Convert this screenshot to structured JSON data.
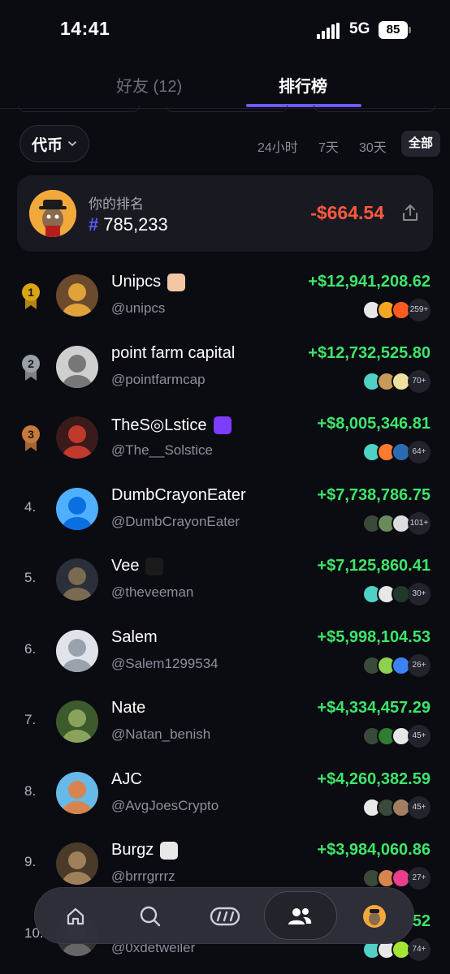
{
  "status": {
    "time": "14:41",
    "network": "5G",
    "battery": "85"
  },
  "tabs": {
    "friends": "好友 (12)",
    "ranking": "排行榜"
  },
  "filters": {
    "token_select": "代币",
    "periods": [
      "24小时",
      "7天",
      "30天",
      "全部"
    ],
    "selected": "全部"
  },
  "my_rank": {
    "label": "你的排名",
    "hash": "#",
    "value": "785,233",
    "pnl": "-$664.54"
  },
  "leaderboard": [
    {
      "rank": "1",
      "name": "Unipcs",
      "handle": "@unipcs",
      "pnl": "+$12,941,208.62",
      "more": "259+",
      "medal": "gold"
    },
    {
      "rank": "2",
      "name": "point farm capital",
      "handle": "@pointfarmcap",
      "pnl": "+$12,732,525.80",
      "more": "70+",
      "medal": "silver"
    },
    {
      "rank": "3",
      "name": "TheS◎Lstice",
      "handle": "@The__Solstice",
      "pnl": "+$8,005,346.81",
      "more": "64+",
      "medal": "bronze"
    },
    {
      "rank": "4.",
      "name": "DumbCrayonEater",
      "handle": "@DumbCrayonEater",
      "pnl": "+$7,738,786.75",
      "more": "101+"
    },
    {
      "rank": "5.",
      "name": "Vee",
      "handle": "@theveeman",
      "pnl": "+$7,125,860.41",
      "more": "30+"
    },
    {
      "rank": "6.",
      "name": "Salem",
      "handle": "@Salem1299534",
      "pnl": "+$5,998,104.53",
      "more": "26+"
    },
    {
      "rank": "7.",
      "name": "Nate",
      "handle": "@Natan_benish",
      "pnl": "+$4,334,457.29",
      "more": "45+"
    },
    {
      "rank": "8.",
      "name": "AJC",
      "handle": "@AvgJoesCrypto",
      "pnl": "+$4,260,382.59",
      "more": "45+"
    },
    {
      "rank": "9.",
      "name": "Burgz",
      "handle": "@brrrgrrrz",
      "pnl": "+$3,984,060.86",
      "more": "27+"
    },
    {
      "rank": "10.",
      "name": "",
      "handle": "@0xdetweiler",
      "pnl": "52",
      "more": "74+"
    }
  ],
  "nav": [
    "home-icon",
    "search-icon",
    "token-icon",
    "friends-icon",
    "profile-avatar"
  ],
  "colors": {
    "accent": "#6a5cff",
    "positive": "#3ee56a",
    "negative": "#ff5a3c"
  }
}
